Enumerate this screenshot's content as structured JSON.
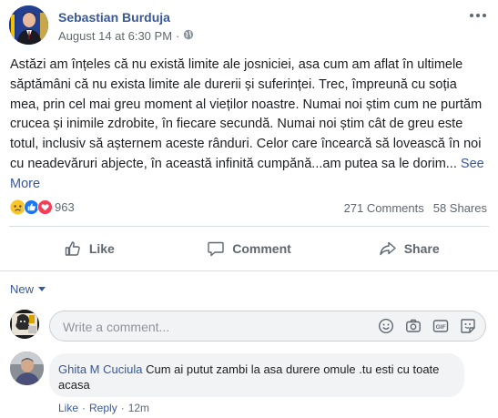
{
  "post": {
    "author": "Sebastian Burduja",
    "timestamp": "August 14 at 6:30 PM",
    "separator": "·",
    "audience_icon": "globe-icon",
    "body": "Astăzi am înțeles că nu există limite ale josniciei, asa cum am aflat în ultimele săptămâni că nu exista limite ale durerii și suferinței. Trec, împreună cu soția mea, prin cel mai greu moment al vieților noastre. Numai noi știm cum ne purtăm crucea și inimile zdrobite, în fiecare secundă. Numai noi știm cât de greu este totul, inclusiv să așternem aceste rânduri. Celor care încearcă să lovească în noi cu neadevăruri abjecte, în această infinită cumpănă...am putea sa le dorim...",
    "see_more": "See More"
  },
  "reactions": {
    "count": "963",
    "icons": [
      "sad-icon",
      "like-icon",
      "love-icon"
    ],
    "comments": "271 Comments",
    "shares": "58 Shares"
  },
  "actions": {
    "like": "Like",
    "comment": "Comment",
    "share": "Share"
  },
  "comments_section": {
    "sort_label": "New",
    "input_placeholder": "Write a comment...",
    "comments": [
      {
        "author": "Ghita M Cuciula",
        "text": "Cum ai putut zambi la asa durere omule .tu esti cu toate acasa",
        "like_label": "Like",
        "reply_label": "Reply",
        "separator": "·",
        "time": "12m"
      }
    ]
  },
  "colors": {
    "link": "#385898",
    "secondary_text": "#606770",
    "divider": "#dadde1",
    "bubble": "#f2f3f5"
  }
}
